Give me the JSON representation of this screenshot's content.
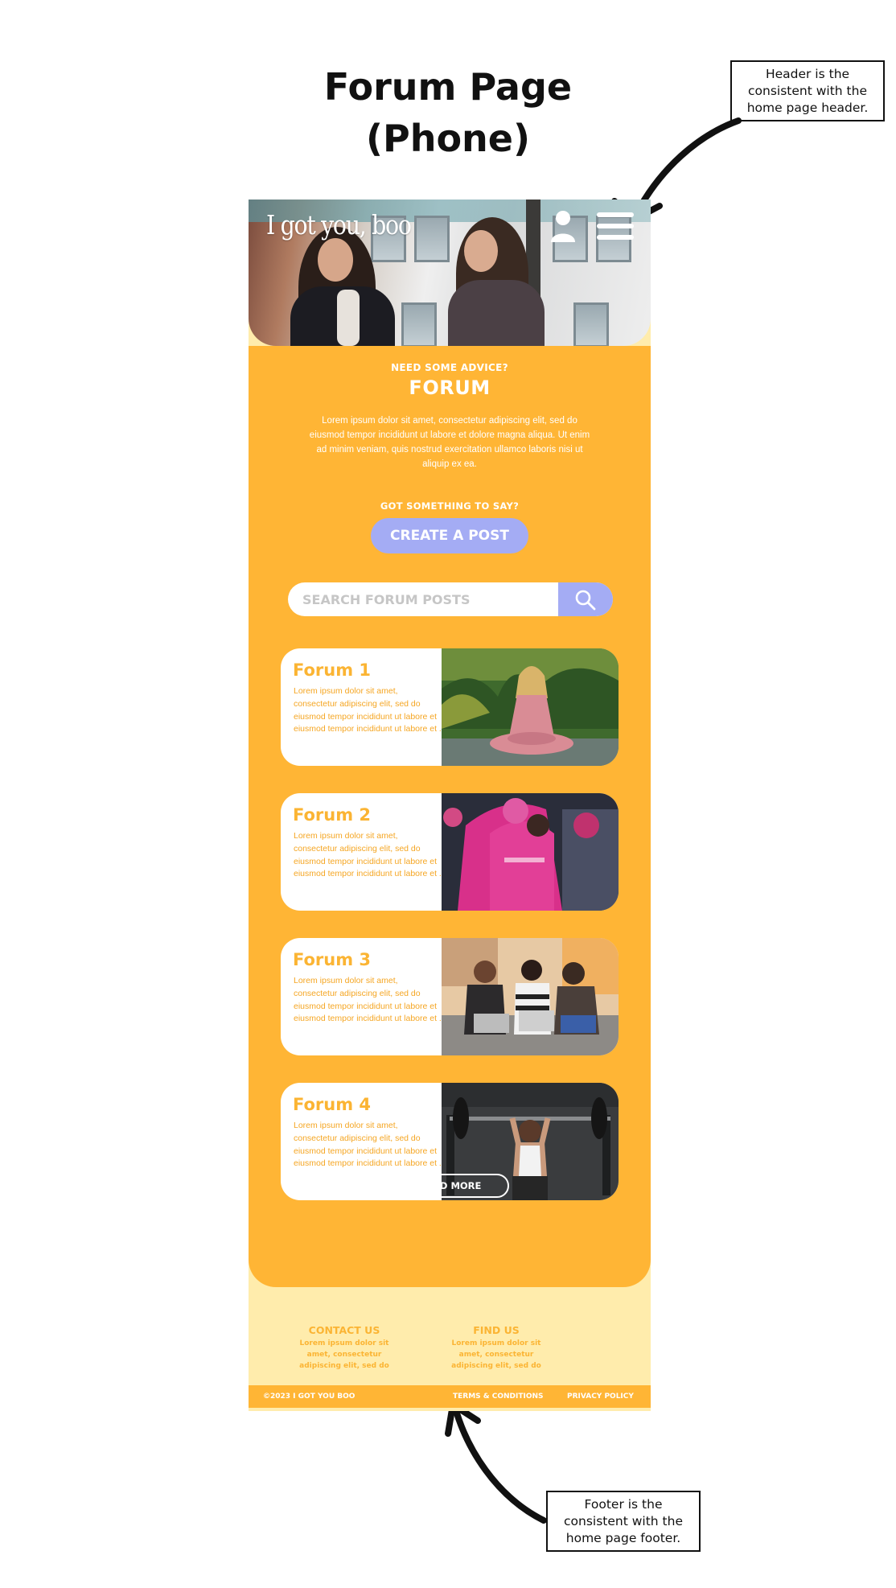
{
  "page": {
    "title_line1": "Forum Page",
    "title_line2": "(Phone)"
  },
  "annotations": {
    "header_note": "Header is the consistent with the home page header.",
    "footer_note": "Footer is the consistent with the home page footer."
  },
  "header": {
    "logo": "I got you, boo",
    "icons": [
      "user-icon",
      "menu-icon"
    ]
  },
  "intro": {
    "eyebrow": "NEED SOME ADVICE?",
    "heading": "FORUM",
    "body": "Lorem ipsum dolor sit amet, consectetur adipiscing elit, sed do eiusmod tempor incididunt ut labore et dolore magna aliqua. Ut enim ad minim veniam, quis nostrud exercitation ullamco laboris nisi ut aliquip ex ea."
  },
  "create": {
    "eyebrow": "GOT SOMETHING TO SAY?",
    "button": "CREATE A POST"
  },
  "search": {
    "placeholder": "SEARCH FORUM POSTS",
    "icon": "search-icon"
  },
  "forums": [
    {
      "title": "Forum 1",
      "text": "Lorem ipsum dolor sit amet, consectetur adipiscing elit, sed do eiusmod tempor incididunt ut labore et eiusmod tempor incididunt ut labore et ."
    },
    {
      "title": "Forum 2",
      "text": "Lorem ipsum dolor sit amet, consectetur adipiscing elit, sed do eiusmod tempor incididunt ut labore et eiusmod tempor incididunt ut labore et ."
    },
    {
      "title": "Forum 3",
      "text": "Lorem ipsum dolor sit amet, consectetur adipiscing elit, sed do eiusmod tempor incididunt ut labore et eiusmod tempor incididunt ut labore et ."
    },
    {
      "title": "Forum 4",
      "text": "Lorem ipsum dolor sit amet, consectetur adipiscing elit, sed do eiusmod tempor incididunt ut labore et eiusmod tempor incididunt ut labore et ."
    }
  ],
  "load_more": "LOAD MORE",
  "footer": {
    "contact_heading": "CONTACT US",
    "contact_text": "Lorem ipsum dolor sit amet, consectetur adipiscing elit, sed do",
    "find_heading": "FIND US",
    "find_text": "Lorem ipsum dolor sit amet, consectetur adipiscing elit, sed do",
    "copyright": "©2023 I GOT YOU BOO",
    "terms": "TERMS & CONDITIONS",
    "privacy": "PRIVACY POLICY"
  },
  "colors": {
    "orange": "#ffb535",
    "light_yellow": "#ffecac",
    "periwinkle": "#a4acf4",
    "card_text": "#fbb433"
  }
}
